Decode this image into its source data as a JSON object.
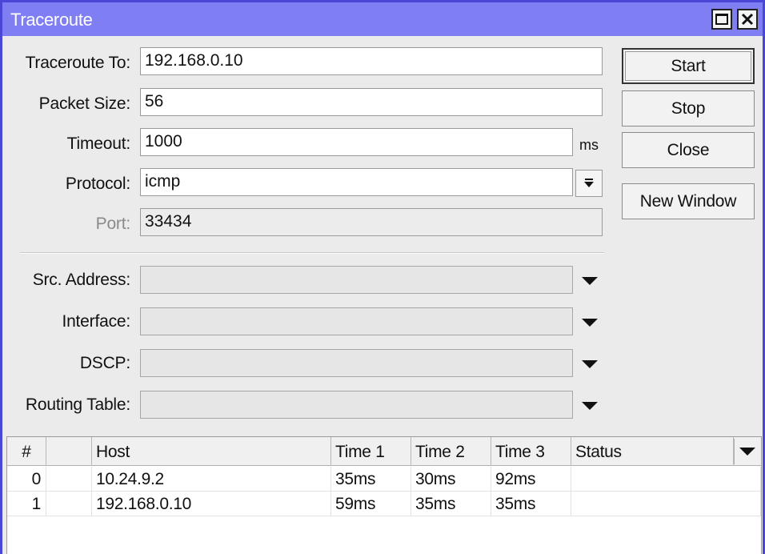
{
  "window": {
    "title": "Traceroute"
  },
  "form": {
    "traceroute_to": {
      "label": "Traceroute To:",
      "value": "192.168.0.10"
    },
    "packet_size": {
      "label": "Packet Size:",
      "value": "56"
    },
    "timeout": {
      "label": "Timeout:",
      "value": "1000",
      "unit": "ms"
    },
    "protocol": {
      "label": "Protocol:",
      "value": "icmp"
    },
    "port": {
      "label": "Port:",
      "value": "33434"
    },
    "src_address": {
      "label": "Src. Address:",
      "value": ""
    },
    "interface": {
      "label": "Interface:",
      "value": ""
    },
    "dscp": {
      "label": "DSCP:",
      "value": ""
    },
    "routing_table": {
      "label": "Routing Table:",
      "value": ""
    }
  },
  "buttons": {
    "start": "Start",
    "stop": "Stop",
    "close": "Close",
    "new_window": "New Window"
  },
  "table": {
    "columns": [
      "#",
      "",
      "Host",
      "Time 1",
      "Time 2",
      "Time 3",
      "Status"
    ],
    "rows": [
      {
        "num": "0",
        "flag": "",
        "host": "10.24.9.2",
        "time1": "35ms",
        "time2": "30ms",
        "time3": "92ms",
        "status": ""
      },
      {
        "num": "1",
        "flag": "",
        "host": "192.168.0.10",
        "time1": "59ms",
        "time2": "35ms",
        "time3": "35ms",
        "status": ""
      }
    ]
  }
}
